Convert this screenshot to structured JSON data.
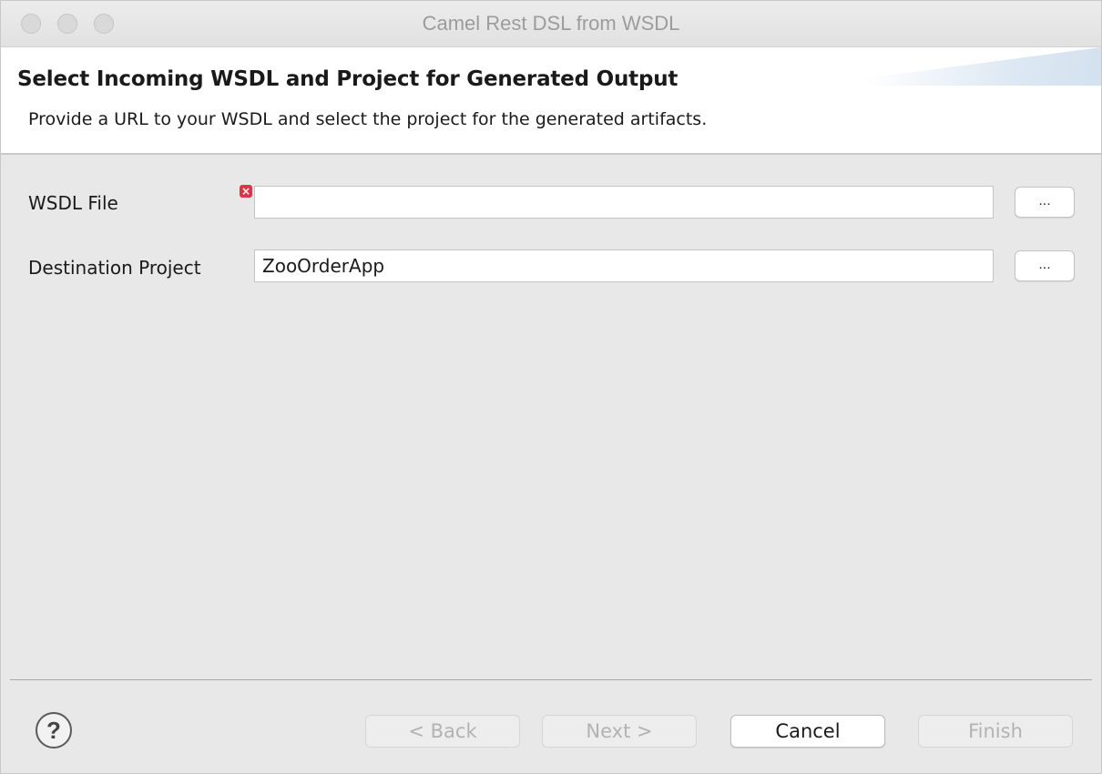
{
  "window": {
    "title": "Camel Rest DSL from WSDL"
  },
  "header": {
    "title": "Select Incoming WSDL and Project for Generated Output",
    "description": "Provide a URL to your WSDL and select the project for the generated artifacts."
  },
  "form": {
    "wsdl_file": {
      "label": "WSDL File",
      "value": "",
      "browse_label": "...",
      "error_icon": "error-icon",
      "error_color": "#d9364a"
    },
    "destination_project": {
      "label": "Destination Project",
      "value": "ZooOrderApp",
      "browse_label": "..."
    }
  },
  "footer": {
    "help_icon": "?",
    "back_label": "< Back",
    "next_label": "Next >",
    "cancel_label": "Cancel",
    "finish_label": "Finish"
  }
}
